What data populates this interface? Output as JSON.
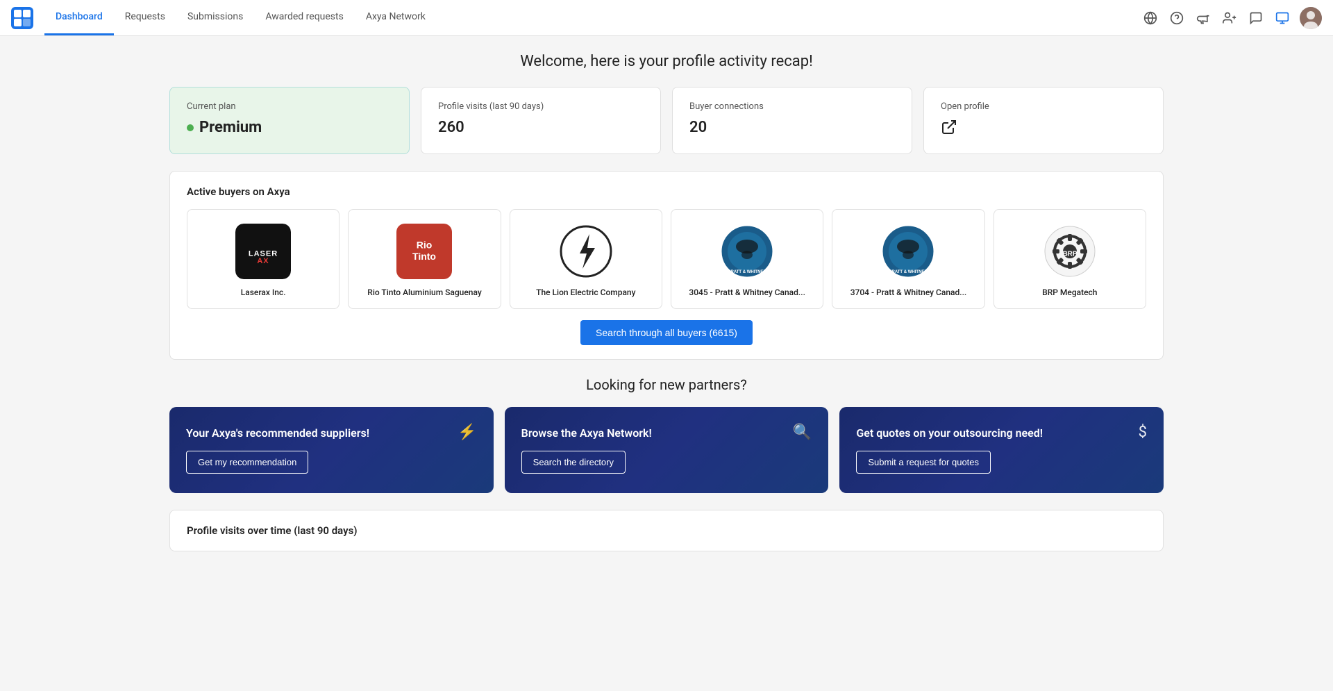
{
  "nav": {
    "tabs": [
      {
        "label": "Dashboard",
        "active": true
      },
      {
        "label": "Requests",
        "active": false
      },
      {
        "label": "Submissions",
        "active": false
      },
      {
        "label": "Awarded requests",
        "active": false
      },
      {
        "label": "Axya Network",
        "active": false
      }
    ],
    "icons": [
      "globe-icon",
      "help-icon",
      "megaphone-icon",
      "person-add-icon",
      "chat-icon",
      "share-icon"
    ]
  },
  "page": {
    "title": "Welcome, here is your profile activity recap!"
  },
  "stats": [
    {
      "label": "Current plan",
      "value": "Premium",
      "type": "plan"
    },
    {
      "label": "Profile visits (last 90 days)",
      "value": "260",
      "type": "number"
    },
    {
      "label": "Buyer connections",
      "value": "20",
      "type": "number"
    },
    {
      "label": "Open profile",
      "value": "",
      "type": "link"
    }
  ],
  "buyers_section": {
    "title": "Active buyers on Axya",
    "buyers": [
      {
        "name": "Laserax Inc.",
        "logo_type": "laserax"
      },
      {
        "name": "Rio Tinto Aluminium Saguenay",
        "logo_type": "riotinto"
      },
      {
        "name": "The Lion Electric Company",
        "logo_type": "lion"
      },
      {
        "name": "3045 - Pratt & Whitney Canad...",
        "logo_type": "pw"
      },
      {
        "name": "3704 - Pratt & Whitney Canad...",
        "logo_type": "pw"
      },
      {
        "name": "BRP Megatech",
        "logo_type": "brp"
      }
    ],
    "search_button": "Search through all buyers (6615)"
  },
  "partners_section": {
    "title": "Looking for new partners?",
    "cards": [
      {
        "title": "Your Axya's recommended suppliers!",
        "icon": "⚡",
        "button": "Get my recommendation"
      },
      {
        "title": "Browse the Axya Network!",
        "icon": "🔍",
        "button": "Search the directory"
      },
      {
        "title": "Get quotes on your outsourcing need!",
        "icon": "$",
        "button": "Submit a request for quotes"
      }
    ]
  },
  "profile_visits": {
    "title": "Profile visits over time (last 90 days)"
  }
}
